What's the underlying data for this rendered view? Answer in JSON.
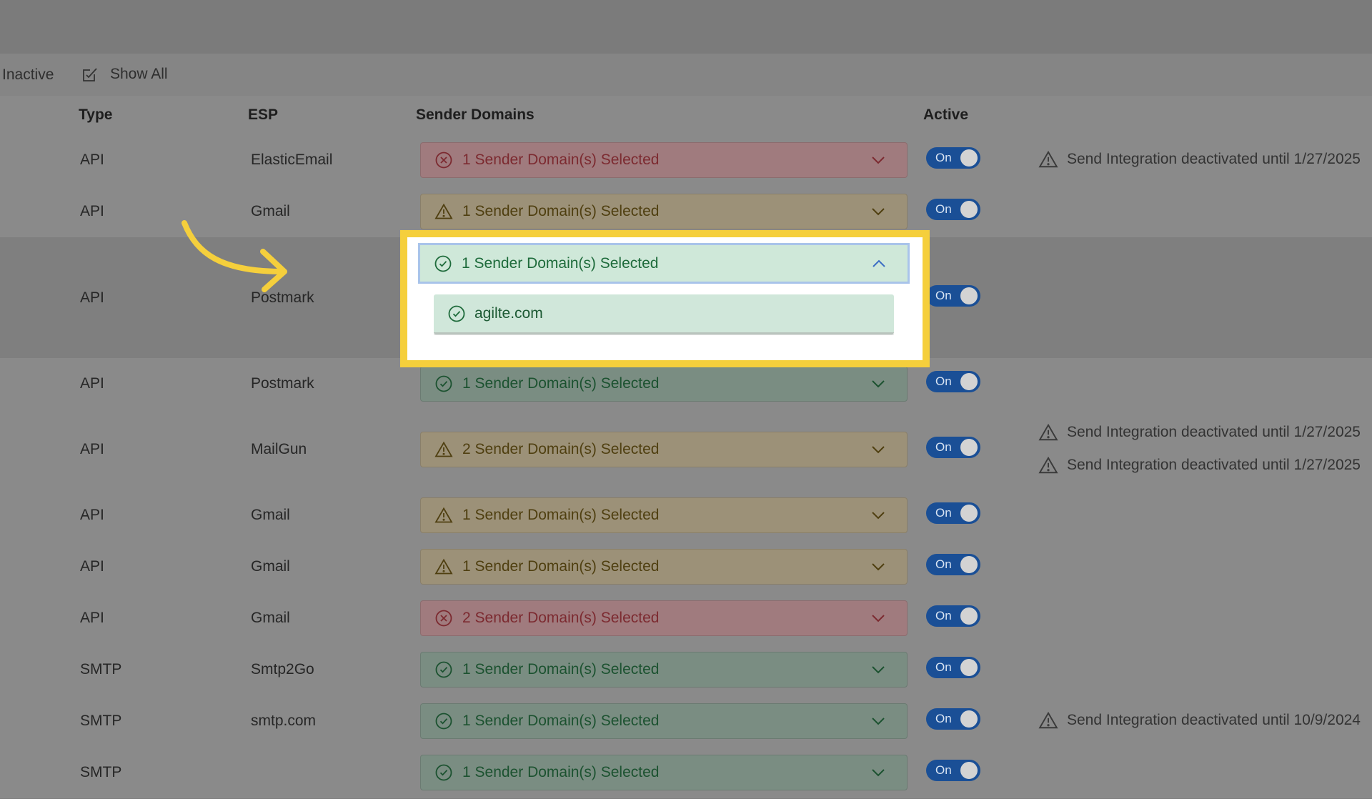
{
  "filters": {
    "inactive_label": "Inactive",
    "show_all_label": "Show All"
  },
  "columns": {
    "type": "Type",
    "esp": "ESP",
    "sender_domains": "Sender Domains",
    "active": "Active"
  },
  "rows": [
    {
      "type": "API",
      "esp": "ElasticEmail",
      "domains": "1 Sender Domain(s) Selected",
      "status": "error",
      "active": "On",
      "warnings": [
        "Send Integration deactivated until 1/27/2025"
      ]
    },
    {
      "type": "API",
      "esp": "Gmail",
      "domains": "1 Sender Domain(s) Selected",
      "status": "warning",
      "active": "On",
      "warnings": []
    },
    {
      "type": "API",
      "esp": "Postmark",
      "domains": "1 Sender Domain(s) Selected",
      "status": "ok",
      "active": "On",
      "warnings": [],
      "expanded": true,
      "options": [
        "agilte.com"
      ]
    },
    {
      "type": "API",
      "esp": "Postmark",
      "domains": "1 Sender Domain(s) Selected",
      "status": "ok",
      "active": "On",
      "warnings": []
    },
    {
      "type": "API",
      "esp": "MailGun",
      "domains": "2 Sender Domain(s) Selected",
      "status": "warning",
      "active": "On",
      "warnings": [
        "Send Integration deactivated until 1/27/2025",
        "Send Integration deactivated until 1/27/2025"
      ]
    },
    {
      "type": "API",
      "esp": "Gmail",
      "domains": "1 Sender Domain(s) Selected",
      "status": "warning",
      "active": "On",
      "warnings": []
    },
    {
      "type": "API",
      "esp": "Gmail",
      "domains": "1 Sender Domain(s) Selected",
      "status": "warning",
      "active": "On",
      "warnings": []
    },
    {
      "type": "API",
      "esp": "Gmail",
      "domains": "2 Sender Domain(s) Selected",
      "status": "error",
      "active": "On",
      "warnings": []
    },
    {
      "type": "SMTP",
      "esp": "Smtp2Go",
      "domains": "1 Sender Domain(s) Selected",
      "status": "ok",
      "active": "On",
      "warnings": []
    },
    {
      "type": "SMTP",
      "esp": "smtp.com",
      "domains": "1 Sender Domain(s) Selected",
      "status": "ok",
      "active": "On",
      "warnings": [
        "Send Integration deactivated until 10/9/2024"
      ]
    },
    {
      "type": "SMTP",
      "esp": "",
      "domains": "1 Sender Domain(s) Selected",
      "status": "ok",
      "active": "On",
      "warnings": []
    }
  ],
  "colors": {
    "highlight": "#f5cf3c",
    "toggle_on": "#1a4f96",
    "ok": "#1e6b3b",
    "warning": "#4f3f10",
    "error": "#7c2a30"
  },
  "icons": {
    "show_all": "checkbox-edit-icon",
    "error": "x-circle-icon",
    "warning": "warning-triangle-icon",
    "ok": "check-circle-icon",
    "chevron": "chevron-down-icon",
    "pointer": "curved-arrow-icon"
  }
}
